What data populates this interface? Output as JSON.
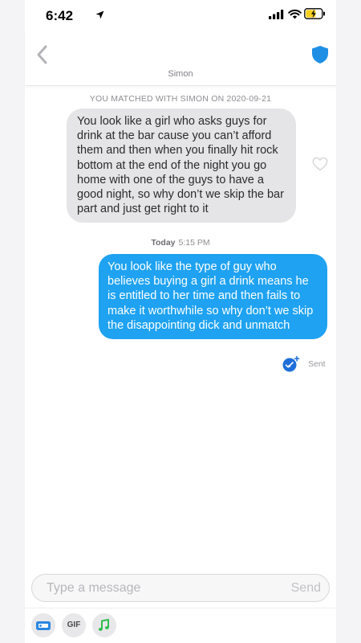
{
  "status_bar": {
    "time": "6:42"
  },
  "header": {
    "contact_name": "Simon"
  },
  "conversation": {
    "match_notice": "YOU MATCHED WITH SIMON ON 2020-09-21",
    "messages": [
      {
        "direction": "incoming",
        "text": "You look like a girl who asks guys for drink at the bar cause you can’t afford them and then when you finally hit rock bottom at the end of the night you go home with one of the guys to have a good night, so why don’t we skip the bar part and just get right to it"
      },
      {
        "direction": "outgoing",
        "day": "Today",
        "time": "5:15 PM",
        "text": "You look like the type of guy who believes buying a girl a drink means he is entitled to her time and then fails to make it worthwhile so why don’t we skip the disappointing dick and unmatch",
        "status": "Sent"
      }
    ]
  },
  "composer": {
    "placeholder": "Type a message",
    "send_label": "Send",
    "tools": [
      {
        "icon": "gif-card-icon"
      },
      {
        "label": "GIF",
        "icon": "gif-icon"
      },
      {
        "icon": "music-note-icon"
      }
    ]
  },
  "colors": {
    "accent": "#1ea2f1",
    "shield": "#1f8fe6",
    "music": "#2fbd4e",
    "incoming_bubble": "#e5e5e7"
  }
}
